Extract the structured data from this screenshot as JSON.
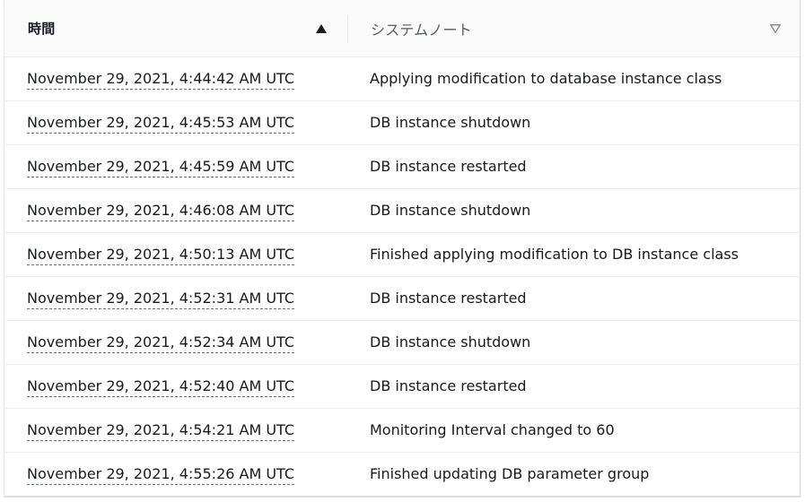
{
  "table": {
    "columns": {
      "time": "時間",
      "system_note": "システムノート"
    },
    "icons": {
      "time_sort": "sort-ascending-icon",
      "note_sort": "sort-descending-icon"
    },
    "colors": {
      "sort_active": "#16191f",
      "sort_inactive": "#879596"
    },
    "rows": [
      {
        "time": "November 29, 2021, 4:44:42 AM UTC",
        "note": "Applying modification to database instance class"
      },
      {
        "time": "November 29, 2021, 4:45:53 AM UTC",
        "note": "DB instance shutdown"
      },
      {
        "time": "November 29, 2021, 4:45:59 AM UTC",
        "note": "DB instance restarted"
      },
      {
        "time": "November 29, 2021, 4:46:08 AM UTC",
        "note": "DB instance shutdown"
      },
      {
        "time": "November 29, 2021, 4:50:13 AM UTC",
        "note": "Finished applying modification to DB instance class"
      },
      {
        "time": "November 29, 2021, 4:52:31 AM UTC",
        "note": "DB instance restarted"
      },
      {
        "time": "November 29, 2021, 4:52:34 AM UTC",
        "note": "DB instance shutdown"
      },
      {
        "time": "November 29, 2021, 4:52:40 AM UTC",
        "note": "DB instance restarted"
      },
      {
        "time": "November 29, 2021, 4:54:21 AM UTC",
        "note": "Monitoring Interval changed to 60"
      },
      {
        "time": "November 29, 2021, 4:55:26 AM UTC",
        "note": "Finished updating DB parameter group"
      }
    ]
  }
}
